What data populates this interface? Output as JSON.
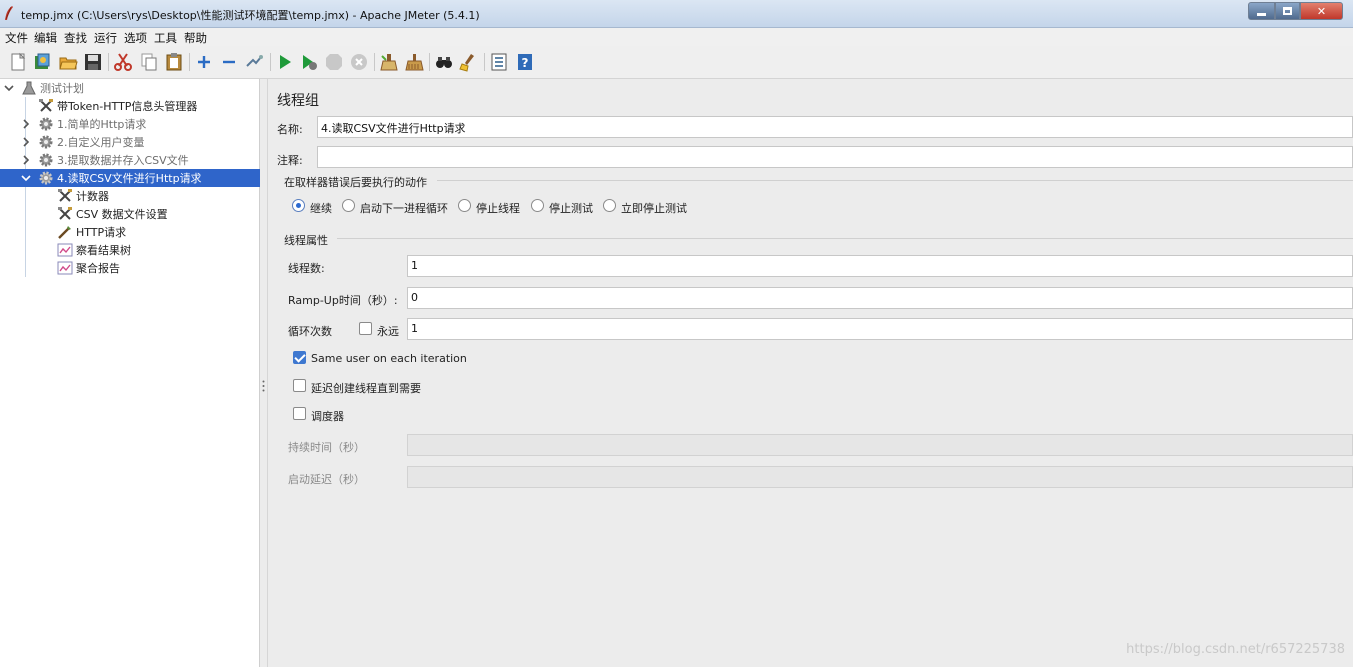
{
  "window": {
    "title": "temp.jmx (C:\\Users\\rys\\Desktop\\性能测试环境配置\\temp.jmx) - Apache JMeter (5.4.1)"
  },
  "menu": [
    "文件",
    "编辑",
    "查找",
    "运行",
    "选项",
    "工具",
    "帮助"
  ],
  "toolbar": {
    "icons": [
      "new-icon",
      "templates-icon",
      "open-icon",
      "save-icon",
      "cut-icon",
      "copy-icon",
      "paste-icon",
      "expand-icon",
      "collapse-icon",
      "toggle-icon",
      "start-icon",
      "start-no-pause-icon",
      "stop-icon",
      "shutdown-icon",
      "clear-icon",
      "clear-all-icon",
      "search-icon",
      "reset-search-icon",
      "function-helper-icon",
      "help-icon"
    ]
  },
  "tree": {
    "items": [
      {
        "label": "测试计划",
        "level": 0,
        "expanded": true,
        "icon": "test-plan-icon"
      },
      {
        "label": "带Token-HTTP信息头管理器",
        "level": 1,
        "icon": "config-icon"
      },
      {
        "label": "1.简单的Http请求",
        "level": 1,
        "icon": "thread-group-icon"
      },
      {
        "label": "2.自定义用户变量",
        "level": 1,
        "icon": "thread-group-icon"
      },
      {
        "label": "3.提取数据并存入CSV文件",
        "level": 1,
        "icon": "thread-group-icon"
      },
      {
        "label": "4.读取CSV文件进行Http请求",
        "level": 1,
        "icon": "thread-group-icon",
        "selected": true
      },
      {
        "label": "计数器",
        "level": 2,
        "icon": "config-icon"
      },
      {
        "label": "CSV 数据文件设置",
        "level": 2,
        "icon": "config-icon"
      },
      {
        "label": "HTTP请求",
        "level": 2,
        "icon": "sampler-icon"
      },
      {
        "label": "察看结果树",
        "level": 2,
        "icon": "listener-icon"
      },
      {
        "label": "聚合报告",
        "level": 2,
        "icon": "listener-icon"
      }
    ]
  },
  "panel": {
    "title": "线程组",
    "name_label": "名称:",
    "name_value": "4.读取CSV文件进行Http请求",
    "comment_label": "注释:",
    "comment_value": "",
    "error_section": "在取样器错误后要执行的动作",
    "error_options": [
      "继续",
      "启动下一进程循环",
      "停止线程",
      "停止测试",
      "立即停止测试"
    ],
    "error_selected": "继续",
    "thread_section": "线程属性",
    "threads_label": "线程数:",
    "threads_value": "1",
    "rampup_label": "Ramp-Up时间（秒）:",
    "rampup_value": "0",
    "loop_label": "循环次数",
    "forever_label": "永远",
    "forever_checked": false,
    "loop_value": "1",
    "same_user_label": "Same user on each iteration",
    "same_user_checked": true,
    "delay_label": "延迟创建线程直到需要",
    "delay_checked": false,
    "scheduler_label": "调度器",
    "scheduler_checked": false,
    "duration_label": "持续时间（秒）",
    "duration_value": "",
    "startup_delay_label": "启动延迟（秒）",
    "startup_delay_value": ""
  },
  "watermark": "https://blog.csdn.net/r657225738"
}
